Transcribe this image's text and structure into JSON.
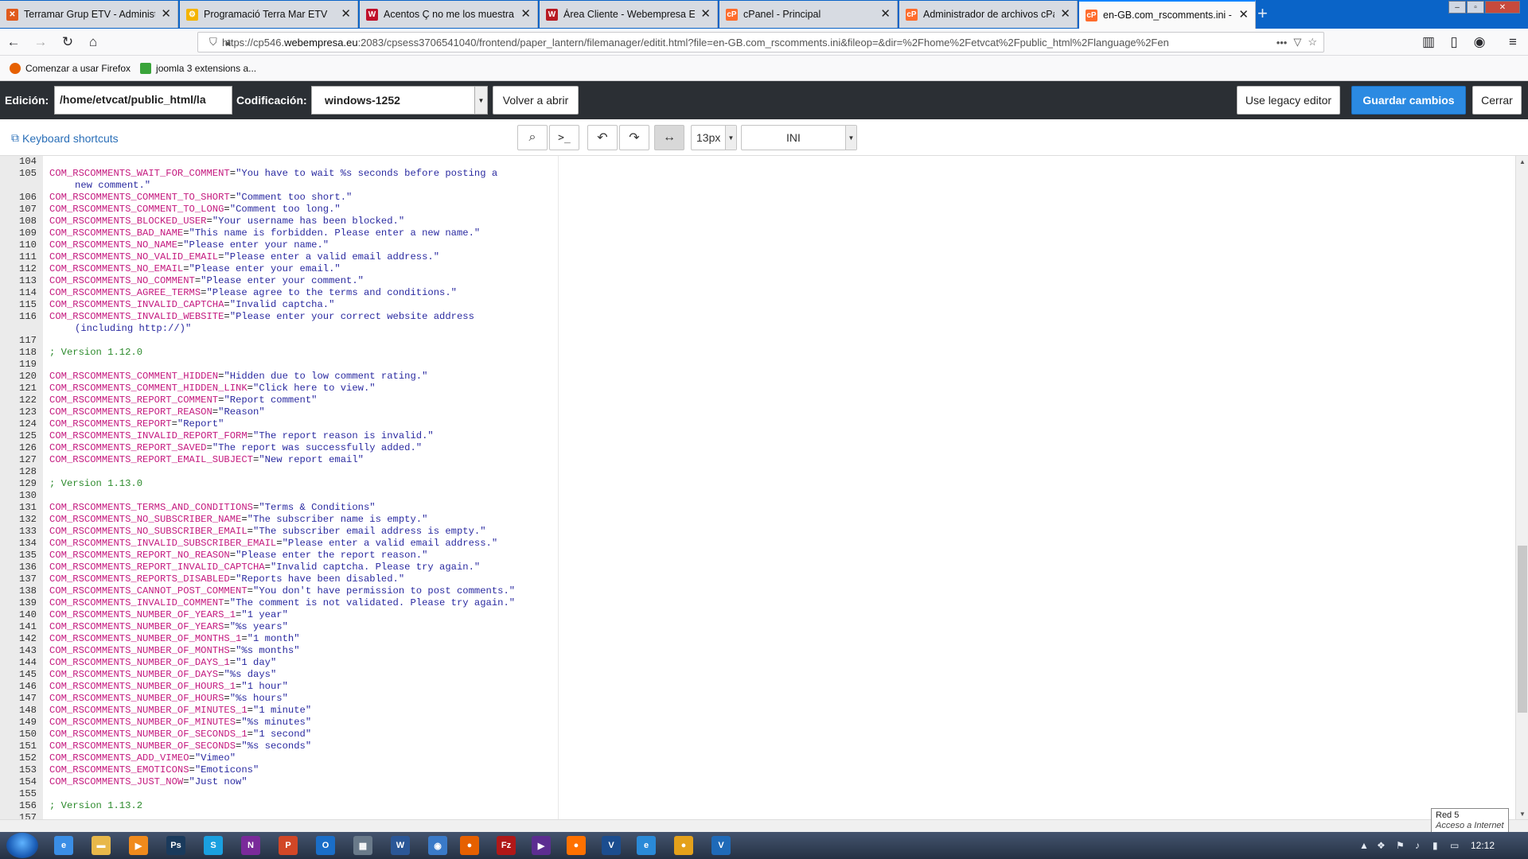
{
  "browser": {
    "tabs": [
      {
        "label": "Terramar Grup ETV - Administ",
        "fav_color": "#e05a1c",
        "fav_char": "✕"
      },
      {
        "label": "Programació Terra Mar ETV",
        "fav_color": "#f4b400",
        "fav_char": "⚙"
      },
      {
        "label": "Acentos Ç no me los muestra -",
        "fav_color": "#c0102a",
        "fav_char": "W"
      },
      {
        "label": "Área Cliente - Webempresa Eu",
        "fav_color": "#b81a22",
        "fav_char": "W"
      },
      {
        "label": "cPanel - Principal",
        "fav_color": "#ff6c2c",
        "fav_char": "cP"
      },
      {
        "label": "Administrador de archivos cPa",
        "fav_color": "#ff6c2c",
        "fav_char": "cP"
      },
      {
        "label": "en-GB.com_rscomments.ini - A",
        "fav_color": "#ff6c2c",
        "fav_char": "cP"
      }
    ],
    "url_prefix": "https://cp546.",
    "url_host": "webempresa.eu",
    "url_rest": ":2083/cpsess3706541040/frontend/paper_lantern/filemanager/editit.html?file=en-GB.com_rscomments.ini&fileop=&dir=%2Fhome%2Fetvcat%2Fpublic_html%2Flanguage%2Fen",
    "bookmarks": [
      {
        "label": "Comenzar a usar Firefox",
        "color": "#e66000"
      },
      {
        "label": "joomla 3 extensions a...",
        "color": "#3aa43a"
      }
    ]
  },
  "editor_toolbar": {
    "edicion_label": "Edición:",
    "path_value": "/home/etvcat/public_html/la",
    "codificacion_label": "Codificación:",
    "encoding_value": "windows-1252",
    "reopen_label": "Volver a abrir",
    "legacy_label": "Use legacy editor",
    "save_label": "Guardar cambios",
    "close_label": "Cerrar"
  },
  "ace_toolbar": {
    "shortcuts_label": "Keyboard shortcuts",
    "font_size": "13px",
    "mode": "INI"
  },
  "code_lines": [
    {
      "n": "104",
      "k": "",
      "v": ""
    },
    {
      "n": "105",
      "k": "COM_RSCOMMENTS_WAIT_FOR_COMMENT",
      "v": "\"You have to wait %s seconds before posting a",
      "cont": "new comment.\""
    },
    {
      "n": "106",
      "k": "COM_RSCOMMENTS_COMMENT_TO_SHORT",
      "v": "\"Comment too short.\""
    },
    {
      "n": "107",
      "k": "COM_RSCOMMENTS_COMMENT_TO_LONG",
      "v": "\"Comment too long.\""
    },
    {
      "n": "108",
      "k": "COM_RSCOMMENTS_BLOCKED_USER",
      "v": "\"Your username has been blocked.\""
    },
    {
      "n": "109",
      "k": "COM_RSCOMMENTS_BAD_NAME",
      "v": "\"This name is forbidden. Please enter a new name.\""
    },
    {
      "n": "110",
      "k": "COM_RSCOMMENTS_NO_NAME",
      "v": "\"Please enter your name.\""
    },
    {
      "n": "111",
      "k": "COM_RSCOMMENTS_NO_VALID_EMAIL",
      "v": "\"Please enter a valid email address.\""
    },
    {
      "n": "112",
      "k": "COM_RSCOMMENTS_NO_EMAIL",
      "v": "\"Please enter your email.\""
    },
    {
      "n": "113",
      "k": "COM_RSCOMMENTS_NO_COMMENT",
      "v": "\"Please enter your comment.\""
    },
    {
      "n": "114",
      "k": "COM_RSCOMMENTS_AGREE_TERMS",
      "v": "\"Please agree to the terms and conditions.\""
    },
    {
      "n": "115",
      "k": "COM_RSCOMMENTS_INVALID_CAPTCHA",
      "v": "\"Invalid captcha.\""
    },
    {
      "n": "116",
      "k": "COM_RSCOMMENTS_INVALID_WEBSITE",
      "v": "\"Please enter your correct website address",
      "cont": "(including http://)\""
    },
    {
      "n": "117",
      "k": "",
      "v": ""
    },
    {
      "n": "118",
      "c": "; Version 1.12.0"
    },
    {
      "n": "119",
      "k": "",
      "v": ""
    },
    {
      "n": "120",
      "k": "COM_RSCOMMENTS_COMMENT_HIDDEN",
      "v": "\"Hidden due to low comment rating.\""
    },
    {
      "n": "121",
      "k": "COM_RSCOMMENTS_COMMENT_HIDDEN_LINK",
      "v": "\"Click here to view.\""
    },
    {
      "n": "122",
      "k": "COM_RSCOMMENTS_REPORT_COMMENT",
      "v": "\"Report comment\""
    },
    {
      "n": "123",
      "k": "COM_RSCOMMENTS_REPORT_REASON",
      "v": "\"Reason\""
    },
    {
      "n": "124",
      "k": "COM_RSCOMMENTS_REPORT",
      "v": "\"Report\""
    },
    {
      "n": "125",
      "k": "COM_RSCOMMENTS_INVALID_REPORT_FORM",
      "v": "\"The report reason is invalid.\""
    },
    {
      "n": "126",
      "k": "COM_RSCOMMENTS_REPORT_SAVED",
      "v": "\"The report was successfully added.\""
    },
    {
      "n": "127",
      "k": "COM_RSCOMMENTS_REPORT_EMAIL_SUBJECT",
      "v": "\"New report email\""
    },
    {
      "n": "128",
      "k": "",
      "v": ""
    },
    {
      "n": "129",
      "c": "; Version 1.13.0"
    },
    {
      "n": "130",
      "k": "",
      "v": ""
    },
    {
      "n": "131",
      "k": "COM_RSCOMMENTS_TERMS_AND_CONDITIONS",
      "v": "\"Terms & Conditions\""
    },
    {
      "n": "132",
      "k": "COM_RSCOMMENTS_NO_SUBSCRIBER_NAME",
      "v": "\"The subscriber name is empty.\""
    },
    {
      "n": "133",
      "k": "COM_RSCOMMENTS_NO_SUBSCRIBER_EMAIL",
      "v": "\"The subscriber email address is empty.\""
    },
    {
      "n": "134",
      "k": "COM_RSCOMMENTS_INVALID_SUBSCRIBER_EMAIL",
      "v": "\"Please enter a valid email address.\""
    },
    {
      "n": "135",
      "k": "COM_RSCOMMENTS_REPORT_NO_REASON",
      "v": "\"Please enter the report reason.\""
    },
    {
      "n": "136",
      "k": "COM_RSCOMMENTS_REPORT_INVALID_CAPTCHA",
      "v": "\"Invalid captcha. Please try again.\""
    },
    {
      "n": "137",
      "k": "COM_RSCOMMENTS_REPORTS_DISABLED",
      "v": "\"Reports have been disabled.\""
    },
    {
      "n": "138",
      "k": "COM_RSCOMMENTS_CANNOT_POST_COMMENT",
      "v": "\"You don't have permission to post comments.\""
    },
    {
      "n": "139",
      "k": "COM_RSCOMMENTS_INVALID_COMMENT",
      "v": "\"The comment is not validated. Please try again.\""
    },
    {
      "n": "140",
      "k": "COM_RSCOMMENTS_NUMBER_OF_YEARS_1",
      "v": "\"1 year\""
    },
    {
      "n": "141",
      "k": "COM_RSCOMMENTS_NUMBER_OF_YEARS",
      "v": "\"%s years\""
    },
    {
      "n": "142",
      "k": "COM_RSCOMMENTS_NUMBER_OF_MONTHS_1",
      "v": "\"1 month\""
    },
    {
      "n": "143",
      "k": "COM_RSCOMMENTS_NUMBER_OF_MONTHS",
      "v": "\"%s months\""
    },
    {
      "n": "144",
      "k": "COM_RSCOMMENTS_NUMBER_OF_DAYS_1",
      "v": "\"1 day\""
    },
    {
      "n": "145",
      "k": "COM_RSCOMMENTS_NUMBER_OF_DAYS",
      "v": "\"%s days\""
    },
    {
      "n": "146",
      "k": "COM_RSCOMMENTS_NUMBER_OF_HOURS_1",
      "v": "\"1 hour\""
    },
    {
      "n": "147",
      "k": "COM_RSCOMMENTS_NUMBER_OF_HOURS",
      "v": "\"%s hours\""
    },
    {
      "n": "148",
      "k": "COM_RSCOMMENTS_NUMBER_OF_MINUTES_1",
      "v": "\"1 minute\""
    },
    {
      "n": "149",
      "k": "COM_RSCOMMENTS_NUMBER_OF_MINUTES",
      "v": "\"%s minutes\""
    },
    {
      "n": "150",
      "k": "COM_RSCOMMENTS_NUMBER_OF_SECONDS_1",
      "v": "\"1 second\""
    },
    {
      "n": "151",
      "k": "COM_RSCOMMENTS_NUMBER_OF_SECONDS",
      "v": "\"%s seconds\""
    },
    {
      "n": "152",
      "k": "COM_RSCOMMENTS_ADD_VIMEO",
      "v": "\"Vimeo\""
    },
    {
      "n": "153",
      "k": "COM_RSCOMMENTS_EMOTICONS",
      "v": "\"Emoticons\""
    },
    {
      "n": "154",
      "k": "COM_RSCOMMENTS_JUST_NOW",
      "v": "\"Just now\""
    },
    {
      "n": "155",
      "k": "",
      "v": ""
    },
    {
      "n": "156",
      "c": "; Version 1.13.2"
    },
    {
      "n": "157",
      "k": "",
      "v": ""
    }
  ],
  "tooltip": {
    "line1": "Red  5",
    "line2": "Acceso a Internet"
  },
  "taskbar": {
    "clock": "12:12",
    "items": [
      {
        "icon": "ie-icon",
        "color": "#3a8ee6",
        "char": "e"
      },
      {
        "icon": "folder-icon",
        "color": "#e8b84a",
        "char": "▬"
      },
      {
        "icon": "media-player-icon",
        "color": "#f08a1c",
        "char": "▶"
      },
      {
        "icon": "photoshop-icon",
        "color": "#1a3a5c",
        "char": "Ps"
      },
      {
        "icon": "skype-icon",
        "color": "#1aa0e0",
        "char": "S"
      },
      {
        "icon": "onenote-icon",
        "color": "#7a2a9a",
        "char": "N"
      },
      {
        "icon": "powerpoint-icon",
        "color": "#d24726",
        "char": "P"
      },
      {
        "icon": "outlook-icon",
        "color": "#1a6ec8",
        "char": "O"
      },
      {
        "icon": "calculator-icon",
        "color": "#6a7a8a",
        "char": "▦"
      },
      {
        "icon": "word-icon",
        "color": "#2b5797",
        "char": "W"
      },
      {
        "icon": "remote-icon",
        "color": "#3a7ac8",
        "char": "◉"
      },
      {
        "icon": "firefox-icon",
        "color": "#e66000",
        "char": "●"
      },
      {
        "icon": "filezilla-icon",
        "color": "#b01818",
        "char": "Fz"
      },
      {
        "icon": "vs-icon",
        "color": "#5c2d91",
        "char": "▶"
      },
      {
        "icon": "firefox-dev-icon",
        "color": "#ff7100",
        "char": "●"
      },
      {
        "icon": "vstudio-icon",
        "color": "#1b4d8f",
        "char": "V"
      },
      {
        "icon": "edge-icon",
        "color": "#2a8ad8",
        "char": "e"
      },
      {
        "icon": "chrome-icon",
        "color": "#e4a11b",
        "char": "●"
      },
      {
        "icon": "vs-code-icon",
        "color": "#1f6ab8",
        "char": "V"
      }
    ]
  }
}
